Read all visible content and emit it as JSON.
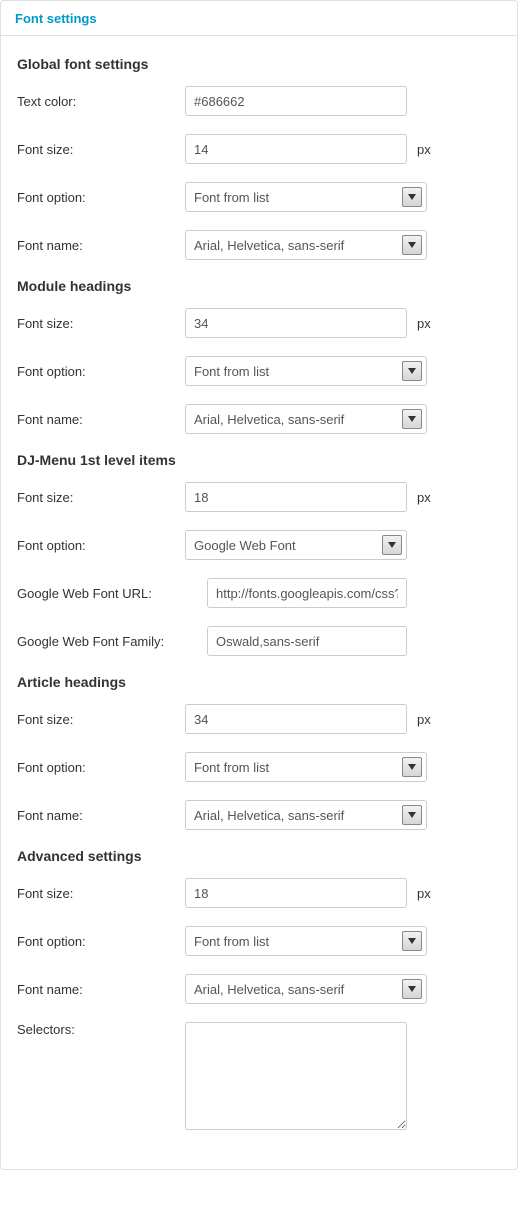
{
  "panel_title": "Font settings",
  "sections": {
    "global": {
      "title": "Global font settings",
      "text_color_label": "Text color:",
      "text_color_value": "#686662",
      "font_size_label": "Font size:",
      "font_size_value": "14",
      "font_size_suffix": "px",
      "font_option_label": "Font option:",
      "font_option_value": "Font from list",
      "font_name_label": "Font name:",
      "font_name_value": "Arial, Helvetica, sans-serif"
    },
    "module": {
      "title": "Module headings",
      "font_size_label": "Font size:",
      "font_size_value": "34",
      "font_size_suffix": "px",
      "font_option_label": "Font option:",
      "font_option_value": "Font from list",
      "font_name_label": "Font name:",
      "font_name_value": "Arial, Helvetica, sans-serif"
    },
    "djmenu": {
      "title": "DJ-Menu 1st level items",
      "font_size_label": "Font size:",
      "font_size_value": "18",
      "font_size_suffix": "px",
      "font_option_label": "Font option:",
      "font_option_value": "Google Web Font",
      "gwf_url_label": "Google Web Font URL:",
      "gwf_url_value": "http://fonts.googleapis.com/css?fam",
      "gwf_family_label": "Google Web Font Family:",
      "gwf_family_value": "Oswald,sans-serif"
    },
    "article": {
      "title": "Article headings",
      "font_size_label": "Font size:",
      "font_size_value": "34",
      "font_size_suffix": "px",
      "font_option_label": "Font option:",
      "font_option_value": "Font from list",
      "font_name_label": "Font name:",
      "font_name_value": "Arial, Helvetica, sans-serif"
    },
    "advanced": {
      "title": "Advanced settings",
      "font_size_label": "Font size:",
      "font_size_value": "18",
      "font_size_suffix": "px",
      "font_option_label": "Font option:",
      "font_option_value": "Font from list",
      "font_name_label": "Font name:",
      "font_name_value": "Arial, Helvetica, sans-serif",
      "selectors_label": "Selectors:",
      "selectors_value": ""
    }
  }
}
